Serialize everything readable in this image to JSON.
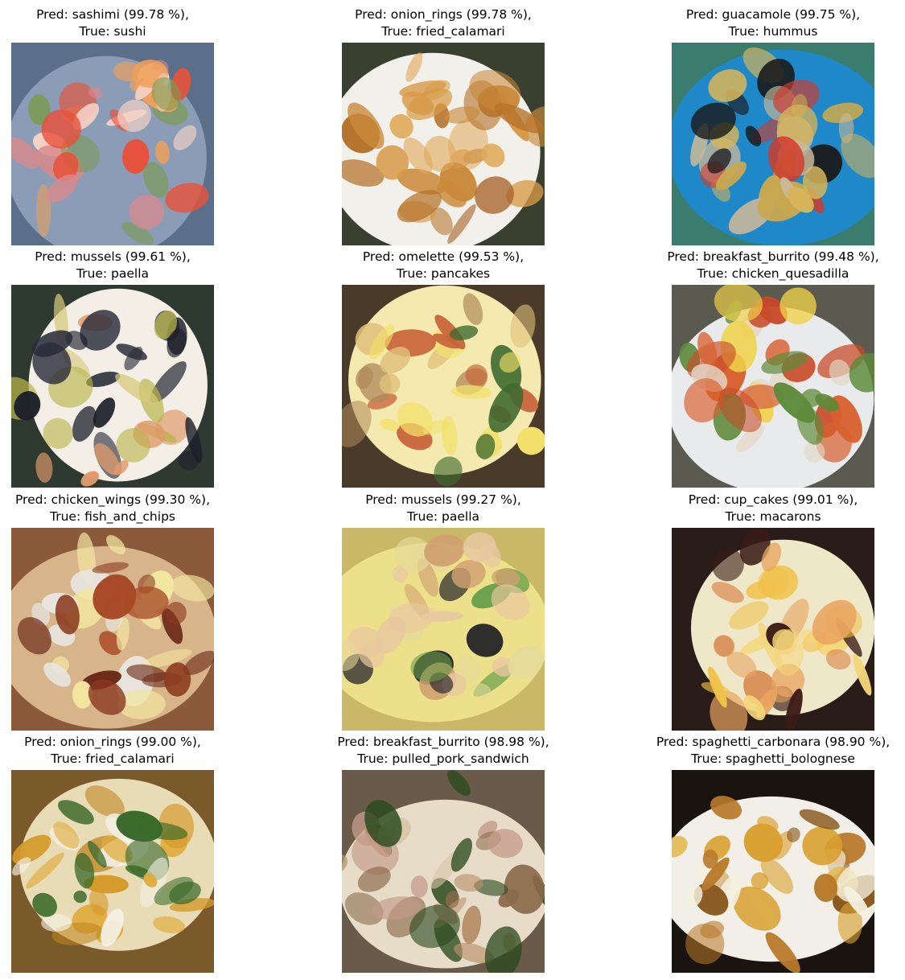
{
  "figure": {
    "panels": [
      {
        "pred_line": "Pred: sashimi (99.78 %),",
        "true_line": "True: sushi",
        "photo": "sushi-photo",
        "palette": {
          "bg": "#5c6f8a",
          "plate": "#8a9cb6",
          "food": [
            "#e8513a",
            "#d98a8c",
            "#f0a05a",
            "#f4d2c6",
            "#7a9b52"
          ]
        }
      },
      {
        "pred_line": "Pred: onion_rings (99.78 %),",
        "true_line": "True: fried_calamari",
        "photo": "fried-calamari-photo",
        "palette": {
          "bg": "#3a4030",
          "plate": "#f2f0ea",
          "food": [
            "#c98a3a",
            "#d79a48",
            "#b5722a",
            "#e0aa5a",
            "#a8642a"
          ]
        }
      },
      {
        "pred_line": "Pred: guacamole (99.75 %),",
        "true_line": "True: hummus",
        "photo": "hummus-photo",
        "palette": {
          "bg": "#3a7d6e",
          "plate": "#1e88c8",
          "food": [
            "#c8a850",
            "#d4b45a",
            "#1a1a1a",
            "#d23a2a",
            "#c9b89a"
          ]
        }
      },
      {
        "pred_line": "Pred: mussels (99.61 %),",
        "true_line": "True: paella",
        "photo": "paella-photo",
        "palette": {
          "bg": "#2e3a30",
          "plate": "#f3efe6",
          "food": [
            "#1c1e2a",
            "#b8b44a",
            "#d6c878",
            "#2a2c3a",
            "#e09a6a"
          ]
        }
      },
      {
        "pred_line": "Pred: omelette (99.53 %),",
        "true_line": "True: pancakes",
        "photo": "pancakes-photo",
        "palette": {
          "bg": "#4a3a2a",
          "plate": "#f4eab0",
          "food": [
            "#f2e06a",
            "#3e6a30",
            "#b08a5a",
            "#c8643a",
            "#e0c07a"
          ]
        }
      },
      {
        "pred_line": "Pred: breakfast_burrito (99.48 %),",
        "true_line": "True: chicken_quesadilla",
        "photo": "chicken-quesadilla-photo",
        "palette": {
          "bg": "#5a5a50",
          "plate": "#e8eaec",
          "food": [
            "#e2d8c6",
            "#d8602e",
            "#c84a28",
            "#5e8a3a",
            "#f0d24a"
          ]
        }
      },
      {
        "pred_line": "Pred: chicken_wings (99.30 %),",
        "true_line": "True: fish_and_chips",
        "photo": "fish-and-chips-photo",
        "palette": {
          "bg": "#8a5a3a",
          "plate": "#d8b48a",
          "food": [
            "#8a3a1e",
            "#a84a26",
            "#6a2a18",
            "#f2e6a0",
            "#e8e6e0"
          ]
        }
      },
      {
        "pred_line": "Pred: mussels (99.27 %),",
        "true_line": "True: paella",
        "photo": "paella-mussels-photo",
        "palette": {
          "bg": "#c8b868",
          "plate": "#ece08a",
          "food": [
            "#1a1c24",
            "#e8c8a0",
            "#d0a070",
            "#e6da9a",
            "#6aa04a"
          ]
        }
      },
      {
        "pred_line": "Pred: cup_cakes (99.01 %),",
        "true_line": "True: macarons",
        "photo": "macarons-photo",
        "palette": {
          "bg": "#2a1c18",
          "plate": "#efe8c8",
          "food": [
            "#f0c24a",
            "#e8a460",
            "#3a1c16",
            "#f4d67a",
            "#d88a50"
          ]
        }
      },
      {
        "pred_line": "Pred: onion_rings (99.00 %),",
        "true_line": "True: fried_calamari",
        "photo": "fried-calamari-photo-2",
        "palette": {
          "bg": "#7a5a2a",
          "plate": "#e8dcb6",
          "food": [
            "#d49a2a",
            "#e0aa3a",
            "#c08420",
            "#f4f0e4",
            "#3a6a2a"
          ]
        }
      },
      {
        "pred_line": "Pred: breakfast_burrito (98.98 %),",
        "true_line": "True: pulled_pork_sandwich",
        "photo": "pulled-pork-sandwich-photo",
        "palette": {
          "bg": "#6a5a4a",
          "plate": "#e6dcc8",
          "food": [
            "#b8926a",
            "#2a4a1e",
            "#c49a8a",
            "#8a6a4a",
            "#d8c4a8"
          ]
        }
      },
      {
        "pred_line": "Pred: spaghetti_carbonara (98.90 %),",
        "true_line": "True: spaghetti_bolognese",
        "photo": "spaghetti-bolognese-photo",
        "palette": {
          "bg": "#1a1410",
          "plate": "#f2efe8",
          "food": [
            "#d8a030",
            "#b87a2a",
            "#f4f0e0",
            "#8a5a20",
            "#e4b84a"
          ]
        }
      }
    ]
  }
}
